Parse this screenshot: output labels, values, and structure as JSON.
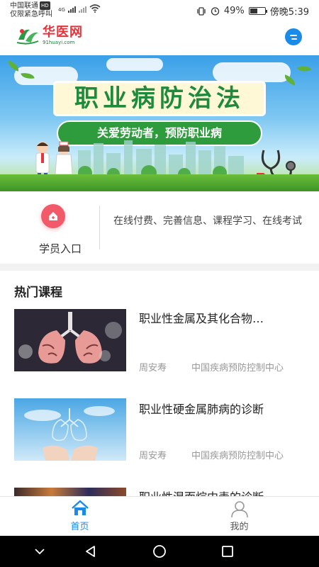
{
  "status_bar": {
    "carrier": "中国联通",
    "hd": "HD",
    "emergency": "仅限紧急呼叫",
    "network": "4G",
    "battery": "49%",
    "battery_level": 0.49,
    "time": "傍晚5:39"
  },
  "header": {
    "logo_name": "华医网",
    "logo_url": "91huayi.com",
    "brand_color": "#e6323a",
    "accent_color": "#1a8be8",
    "message_icon": "message-icon"
  },
  "banner": {
    "title": "职业病防治法",
    "slogan": "关爱劳动者，预防职业病"
  },
  "entry": {
    "label": "学员入口",
    "description": "在线付费、完善信息、课程学习、在线考试",
    "icon": "home-icon"
  },
  "courses": {
    "section_title": "热门课程",
    "items": [
      {
        "title": "职业性金属及其化合物…",
        "author": "周安寿",
        "org": "中国疾病预防控制中心"
      },
      {
        "title": "职业性硬金属肺病的诊断",
        "author": "周安寿",
        "org": "中国疾病预防控制中心"
      },
      {
        "title": "职业性混而烷中毒的诊断",
        "author": "",
        "org": ""
      }
    ]
  },
  "tabbar": {
    "active_color": "#1a8be8",
    "tabs": [
      {
        "label": "首页",
        "icon": "home-icon",
        "active": true
      },
      {
        "label": "我的",
        "icon": "user-icon",
        "active": false
      }
    ]
  },
  "navbar": {
    "buttons": [
      "chevron-down-icon",
      "back-icon",
      "home-circle-icon",
      "recents-icon"
    ]
  }
}
